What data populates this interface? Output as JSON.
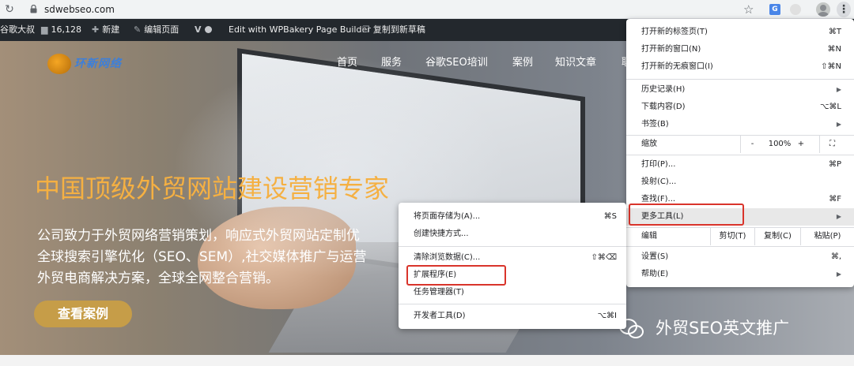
{
  "browser": {
    "url": "sdwebseo.com",
    "reload_icon": "reload-icon",
    "translate_label": "G"
  },
  "adminbar": {
    "site_name": "谷歌大叔",
    "comments_count": "16,128",
    "new_label": "新建",
    "edit_page_label": "编辑页面",
    "wpbakery_label": "Edit with WPBakery Page Builder",
    "copy_draft_label": "复制到新草稿"
  },
  "site": {
    "logo_text": "环新网络",
    "nav": [
      "首页",
      "服务",
      "谷歌SEO培训",
      "案例",
      "知识文章",
      "联"
    ],
    "hero_title": "中国顶级外贸网站建设营销专家",
    "hero_lines": [
      "公司致力于外贸网络营销策划，响应式外贸网站定制优",
      "全球搜索引擎优化（SEO、SEM）,社交媒体推广与运营",
      "外贸电商解决方案，全球全网整合营销。"
    ],
    "cta_label": "查看案例",
    "watermark": "外贸SEO英文推广"
  },
  "chrome_menu": {
    "new_tab": {
      "label": "打开新的标签页(T)",
      "shortcut": "⌘T"
    },
    "new_window": {
      "label": "打开新的窗口(N)",
      "shortcut": "⌘N"
    },
    "incognito": {
      "label": "打开新的无痕窗口(I)",
      "shortcut": "⇧⌘N"
    },
    "history": {
      "label": "历史记录(H)"
    },
    "downloads": {
      "label": "下载内容(D)",
      "shortcut": "⌥⌘L"
    },
    "bookmarks": {
      "label": "书签(B)"
    },
    "zoom": {
      "label": "缩放",
      "minus": "-",
      "value": "100%",
      "plus": "+",
      "fullscreen": "⛶"
    },
    "print": {
      "label": "打印(P)...",
      "shortcut": "⌘P"
    },
    "cast": {
      "label": "投射(C)..."
    },
    "find": {
      "label": "查找(F)...",
      "shortcut": "⌘F"
    },
    "more_tools": {
      "label": "更多工具(L)"
    },
    "edit": {
      "label": "编辑",
      "cut": "剪切(T)",
      "copy": "复制(C)",
      "paste": "粘贴(P)"
    },
    "settings": {
      "label": "设置(S)",
      "shortcut": "⌘,"
    },
    "help": {
      "label": "帮助(E)"
    }
  },
  "more_tools_menu": {
    "save_page": {
      "label": "将页面存储为(A)...",
      "shortcut": "⌘S"
    },
    "create_shortcut": {
      "label": "创建快捷方式..."
    },
    "clear_data": {
      "label": "清除浏览数据(C)...",
      "shortcut": "⇧⌘⌫"
    },
    "extensions": {
      "label": "扩展程序(E)"
    },
    "task_manager": {
      "label": "任务管理器(T)"
    },
    "dev_tools": {
      "label": "开发者工具(D)",
      "shortcut": "⌥⌘I"
    }
  },
  "colors": {
    "highlight_box": "#d9342b",
    "hero_title": "#f5b042",
    "cta_bg": "#c69d48",
    "adminbar_bg": "#23282d"
  }
}
